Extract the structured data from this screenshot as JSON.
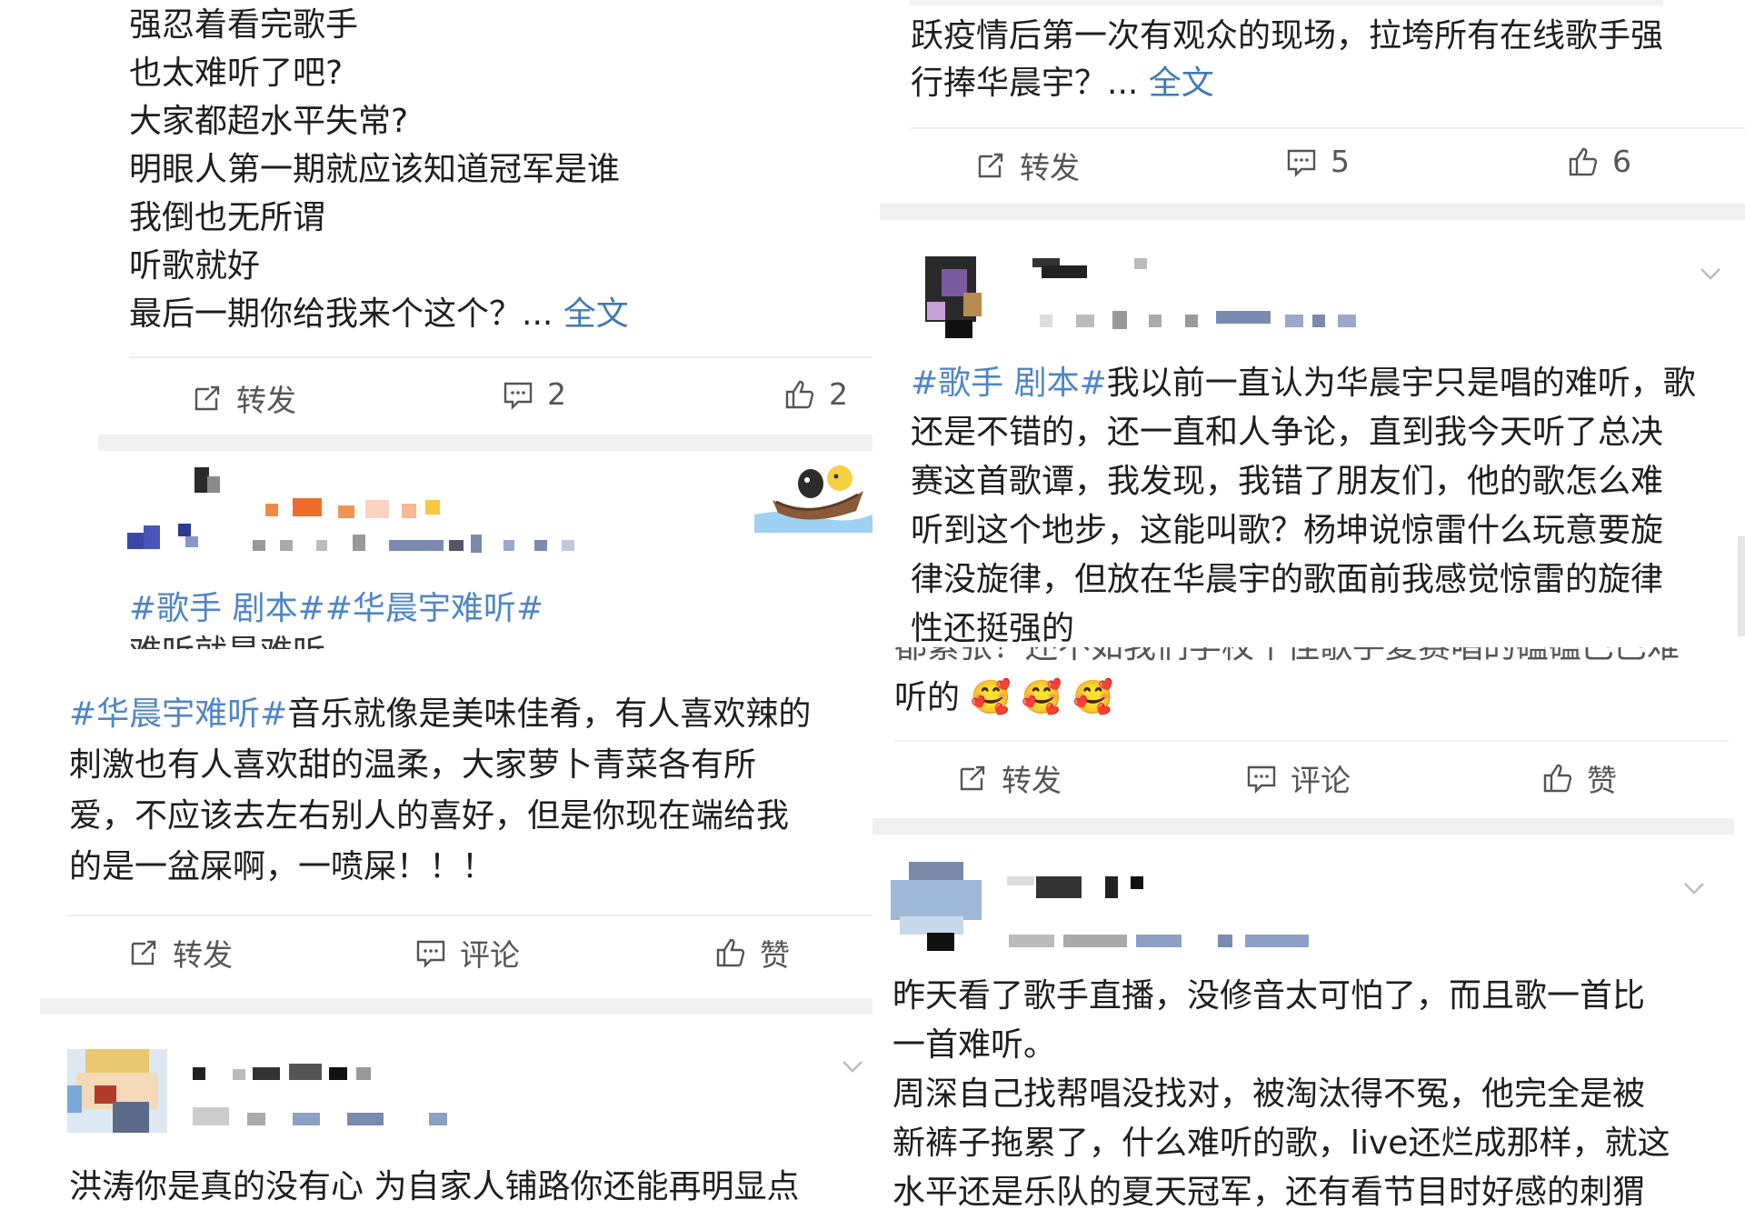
{
  "post1": {
    "lines": [
      "强忍着看完歌手",
      "也太难听了吧?",
      "大家都超水平失常?",
      "明眼人第一期就应该知道冠军是谁",
      "我倒也无所谓",
      "听歌就好",
      "最后一期你给我来个这个？..."
    ],
    "more": "全文",
    "actions": {
      "repost": "转发",
      "comment": "2",
      "like": "2"
    }
  },
  "post2": {
    "tags": "#歌手 剧本##华晨宇难听#",
    "cut_line": "难听就是难听"
  },
  "post3": {
    "tag": "#华晨宇难听#",
    "text_first": "音乐就像是美味佳肴，有人喜欢辣的",
    "lines": [
      "刺激也有人喜欢甜的温柔，大家萝卜青菜各有所",
      "爱，不应该去左右别人的喜好，但是你现在端给我",
      "的是一盆屎啊，一喷屎！！！"
    ],
    "actions": {
      "repost": "转发",
      "comment": "评论",
      "like": "赞"
    }
  },
  "post4": {
    "line": "洪涛你是真的没有心 为自家人铺路你还能再明显点"
  },
  "post5": {
    "lines": [
      "跃疫情后第一次有观众的现场，拉垮所有在线歌手强",
      "行捧华晨宇？..."
    ],
    "more": "全文",
    "actions": {
      "repost": "转发",
      "comment": "5",
      "like": "6"
    }
  },
  "post6": {
    "tag": "#歌手 剧本#",
    "text_first": "我以前一直认为华晨宇只是唱的难听，歌",
    "lines": [
      "还是不错的，还一直和人争论，直到我今天听了总决",
      "赛这首歌谭，我发现，我错了朋友们，他的歌怎么难",
      "听到这个地步，这能叫歌？杨坤说惊雷什么玩意要旋",
      "律没旋律，但放在华晨宇的歌面前我感觉惊雷的旋律",
      "性还挺强的"
    ]
  },
  "post7": {
    "cut_line": "都紧张！还不如我们学校十佳歌手复赛唱的磕磕巴巴难",
    "last_line": "听的",
    "emoji": "🥰",
    "actions": {
      "repost": "转发",
      "comment": "评论",
      "like": "赞"
    }
  },
  "post8": {
    "lines": [
      "昨天看了歌手直播，没修音太可怕了，而且歌一首比",
      "一首难听。",
      "周深自己找帮唱没找对，被淘汰得不冤，他完全是被",
      "新裤子拖累了，什么难听的歌，live还烂成那样，就这",
      "水平还是乐队的夏天冠军，还有看节目时好感的刺猬"
    ]
  },
  "colors": {
    "link": "#3f7ab8",
    "topic": "#4f86c6",
    "text": "#1e1e1e",
    "action": "#555555",
    "separator": "#f0f0f0"
  },
  "icons": [
    "repost-icon",
    "comment-icon",
    "like-icon",
    "chevron-down-icon",
    "avatar",
    "boat-sticker",
    "blush-emoji"
  ]
}
